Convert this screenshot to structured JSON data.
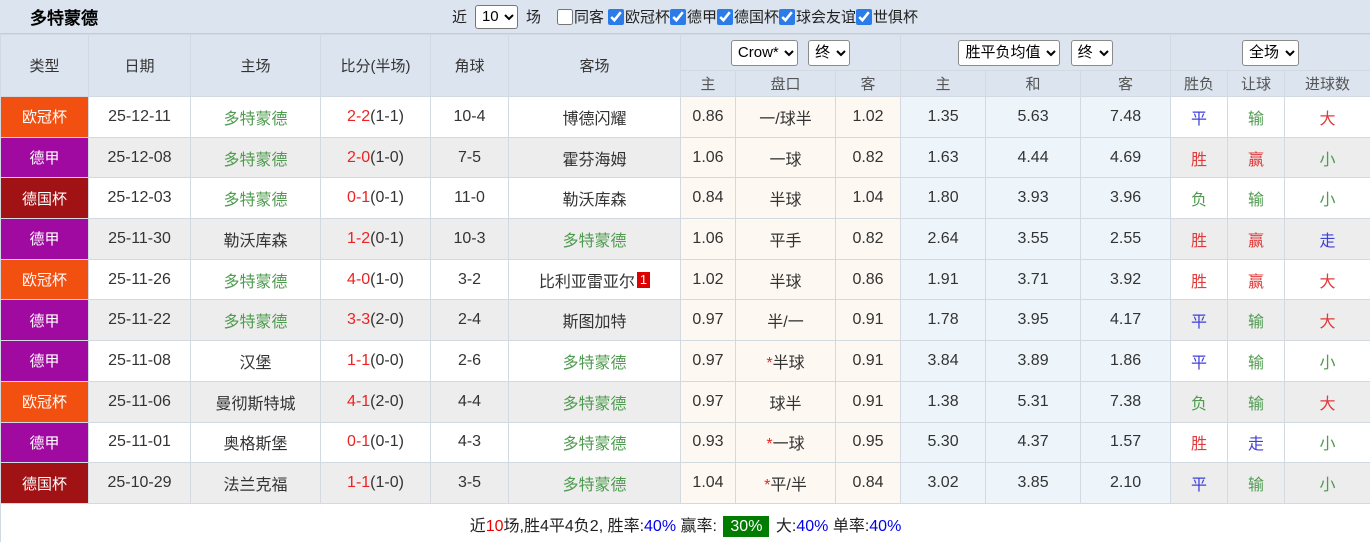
{
  "colors": {
    "accent_checkbox_blue": "#2B7CE9",
    "type_colors": {
      "欧冠杯": "#F25011",
      "德甲": "#A00AA0",
      "德国杯": "#A01214"
    },
    "team_green": "#4F9B4F",
    "score_red": "#EE2222",
    "result_red": "#E03A3A",
    "result_blue": "#4040D8",
    "result_green": "#4F9B4F",
    "summary_badge_green": "#007D00",
    "header_bg": "#DCE5EF",
    "crow_col_bg": "#FDF9F2",
    "avg_col_bg": "#EEF5FA"
  },
  "topbar": {
    "title": "多特蒙德",
    "recent_label": "近",
    "recent_value": "10",
    "matches_label": "场",
    "same_opponent": {
      "label": "同客",
      "checked": false
    },
    "leagues": [
      {
        "label": "欧冠杯",
        "checked": true
      },
      {
        "label": "德甲",
        "checked": true
      },
      {
        "label": "德国杯",
        "checked": true
      },
      {
        "label": "球会友谊",
        "checked": true
      },
      {
        "label": "世俱杯",
        "checked": true
      }
    ]
  },
  "table": {
    "header": {
      "type": "类型",
      "date": "日期",
      "home": "主场",
      "score": "比分(半场)",
      "corner": "角球",
      "away": "客场",
      "selects": {
        "crow": "Crow*",
        "final1": "终",
        "avg": "胜平负均值",
        "final2": "终",
        "fulltime": "全场"
      },
      "sub": {
        "h_home": "主",
        "h_handicap": "盘口",
        "h_away": "客",
        "e_home": "主",
        "e_draw": "和",
        "e_away": "客",
        "r_wdl": "胜负",
        "r_handicap": "让球",
        "r_goals": "进球数"
      }
    },
    "rows": [
      {
        "type": "欧冠杯",
        "date": "25-12-11",
        "home": "多特蒙德",
        "home_green": true,
        "score": "2-2",
        "half": "(1-1)",
        "corner": "10-4",
        "away": "博德闪耀",
        "away_green": false,
        "away_badge": "",
        "crow_home": "0.86",
        "handicap": "一/球半",
        "crow_away": "1.02",
        "euro_home": "1.35",
        "euro_draw": "5.63",
        "euro_away": "7.48",
        "wdl": {
          "text": "平",
          "color": "blue"
        },
        "handicap_result": {
          "text": "输",
          "color": "green"
        },
        "goals": {
          "text": "大",
          "color": "red"
        }
      },
      {
        "type": "德甲",
        "date": "25-12-08",
        "home": "多特蒙德",
        "home_green": true,
        "score": "2-0",
        "half": "(1-0)",
        "corner": "7-5",
        "away": "霍芬海姆",
        "away_green": false,
        "away_badge": "",
        "crow_home": "1.06",
        "handicap": "一球",
        "crow_away": "0.82",
        "euro_home": "1.63",
        "euro_draw": "4.44",
        "euro_away": "4.69",
        "wdl": {
          "text": "胜",
          "color": "red"
        },
        "handicap_result": {
          "text": "赢",
          "color": "red"
        },
        "goals": {
          "text": "小",
          "color": "green"
        }
      },
      {
        "type": "德国杯",
        "date": "25-12-03",
        "home": "多特蒙德",
        "home_green": true,
        "score": "0-1",
        "half": "(0-1)",
        "corner": "11-0",
        "away": "勒沃库森",
        "away_green": false,
        "away_badge": "",
        "crow_home": "0.84",
        "handicap": "半球",
        "crow_away": "1.04",
        "euro_home": "1.80",
        "euro_draw": "3.93",
        "euro_away": "3.96",
        "wdl": {
          "text": "负",
          "color": "green"
        },
        "handicap_result": {
          "text": "输",
          "color": "green"
        },
        "goals": {
          "text": "小",
          "color": "green"
        }
      },
      {
        "type": "德甲",
        "date": "25-11-30",
        "home": "勒沃库森",
        "home_green": false,
        "score": "1-2",
        "half": "(0-1)",
        "corner": "10-3",
        "away": "多特蒙德",
        "away_green": true,
        "away_badge": "",
        "crow_home": "1.06",
        "handicap": "平手",
        "crow_away": "0.82",
        "euro_home": "2.64",
        "euro_draw": "3.55",
        "euro_away": "2.55",
        "wdl": {
          "text": "胜",
          "color": "red"
        },
        "handicap_result": {
          "text": "赢",
          "color": "red"
        },
        "goals": {
          "text": "走",
          "color": "blue"
        }
      },
      {
        "type": "欧冠杯",
        "date": "25-11-26",
        "home": "多特蒙德",
        "home_green": true,
        "score": "4-0",
        "half": "(1-0)",
        "corner": "3-2",
        "away": "比利亚雷亚尔",
        "away_green": false,
        "away_badge": "1",
        "crow_home": "1.02",
        "handicap": "半球",
        "crow_away": "0.86",
        "euro_home": "1.91",
        "euro_draw": "3.71",
        "euro_away": "3.92",
        "wdl": {
          "text": "胜",
          "color": "red"
        },
        "handicap_result": {
          "text": "赢",
          "color": "red"
        },
        "goals": {
          "text": "大",
          "color": "red"
        }
      },
      {
        "type": "德甲",
        "date": "25-11-22",
        "home": "多特蒙德",
        "home_green": true,
        "score": "3-3",
        "half": "(2-0)",
        "corner": "2-4",
        "away": "斯图加特",
        "away_green": false,
        "away_badge": "",
        "crow_home": "0.97",
        "handicap": "半/一",
        "crow_away": "0.91",
        "euro_home": "1.78",
        "euro_draw": "3.95",
        "euro_away": "4.17",
        "wdl": {
          "text": "平",
          "color": "blue"
        },
        "handicap_result": {
          "text": "输",
          "color": "green"
        },
        "goals": {
          "text": "大",
          "color": "red"
        }
      },
      {
        "type": "德甲",
        "date": "25-11-08",
        "home": "汉堡",
        "home_green": false,
        "score": "1-1",
        "half": "(0-0)",
        "corner": "2-6",
        "away": "多特蒙德",
        "away_green": true,
        "away_badge": "",
        "crow_home": "0.97",
        "handicap": "*半球",
        "crow_away": "0.91",
        "euro_home": "3.84",
        "euro_draw": "3.89",
        "euro_away": "1.86",
        "wdl": {
          "text": "平",
          "color": "blue"
        },
        "handicap_result": {
          "text": "输",
          "color": "green"
        },
        "goals": {
          "text": "小",
          "color": "green"
        }
      },
      {
        "type": "欧冠杯",
        "date": "25-11-06",
        "home": "曼彻斯特城",
        "home_green": false,
        "score": "4-1",
        "half": "(2-0)",
        "corner": "4-4",
        "away": "多特蒙德",
        "away_green": true,
        "away_badge": "",
        "crow_home": "0.97",
        "handicap": "球半",
        "crow_away": "0.91",
        "euro_home": "1.38",
        "euro_draw": "5.31",
        "euro_away": "7.38",
        "wdl": {
          "text": "负",
          "color": "green"
        },
        "handicap_result": {
          "text": "输",
          "color": "green"
        },
        "goals": {
          "text": "大",
          "color": "red"
        }
      },
      {
        "type": "德甲",
        "date": "25-11-01",
        "home": "奥格斯堡",
        "home_green": false,
        "score": "0-1",
        "half": "(0-1)",
        "corner": "4-3",
        "away": "多特蒙德",
        "away_green": true,
        "away_badge": "",
        "crow_home": "0.93",
        "handicap": "*一球",
        "crow_away": "0.95",
        "euro_home": "5.30",
        "euro_draw": "4.37",
        "euro_away": "1.57",
        "wdl": {
          "text": "胜",
          "color": "red"
        },
        "handicap_result": {
          "text": "走",
          "color": "blue"
        },
        "goals": {
          "text": "小",
          "color": "green"
        }
      },
      {
        "type": "德国杯",
        "date": "25-10-29",
        "home": "法兰克福",
        "home_green": false,
        "score": "1-1",
        "half": "(1-0)",
        "corner": "3-5",
        "away": "多特蒙德",
        "away_green": true,
        "away_badge": "",
        "crow_home": "1.04",
        "handicap": "*平/半",
        "crow_away": "0.84",
        "euro_home": "3.02",
        "euro_draw": "3.85",
        "euro_away": "2.10",
        "wdl": {
          "text": "平",
          "color": "blue"
        },
        "handicap_result": {
          "text": "输",
          "color": "green"
        },
        "goals": {
          "text": "小",
          "color": "green"
        }
      }
    ]
  },
  "summary": {
    "segments": [
      {
        "text": "近",
        "style": "plain"
      },
      {
        "text": "10",
        "style": "red"
      },
      {
        "text": "场,胜4平4负2, 胜率:",
        "style": "plain"
      },
      {
        "text": "40%",
        "style": "blue"
      },
      {
        "text": " 赢率: ",
        "style": "plain"
      },
      {
        "text": "30%",
        "style": "badge"
      },
      {
        "text": " 大:",
        "style": "plain"
      },
      {
        "text": "40%",
        "style": "blue"
      },
      {
        "text": " 单率:",
        "style": "plain"
      },
      {
        "text": "40%",
        "style": "blue"
      }
    ]
  }
}
